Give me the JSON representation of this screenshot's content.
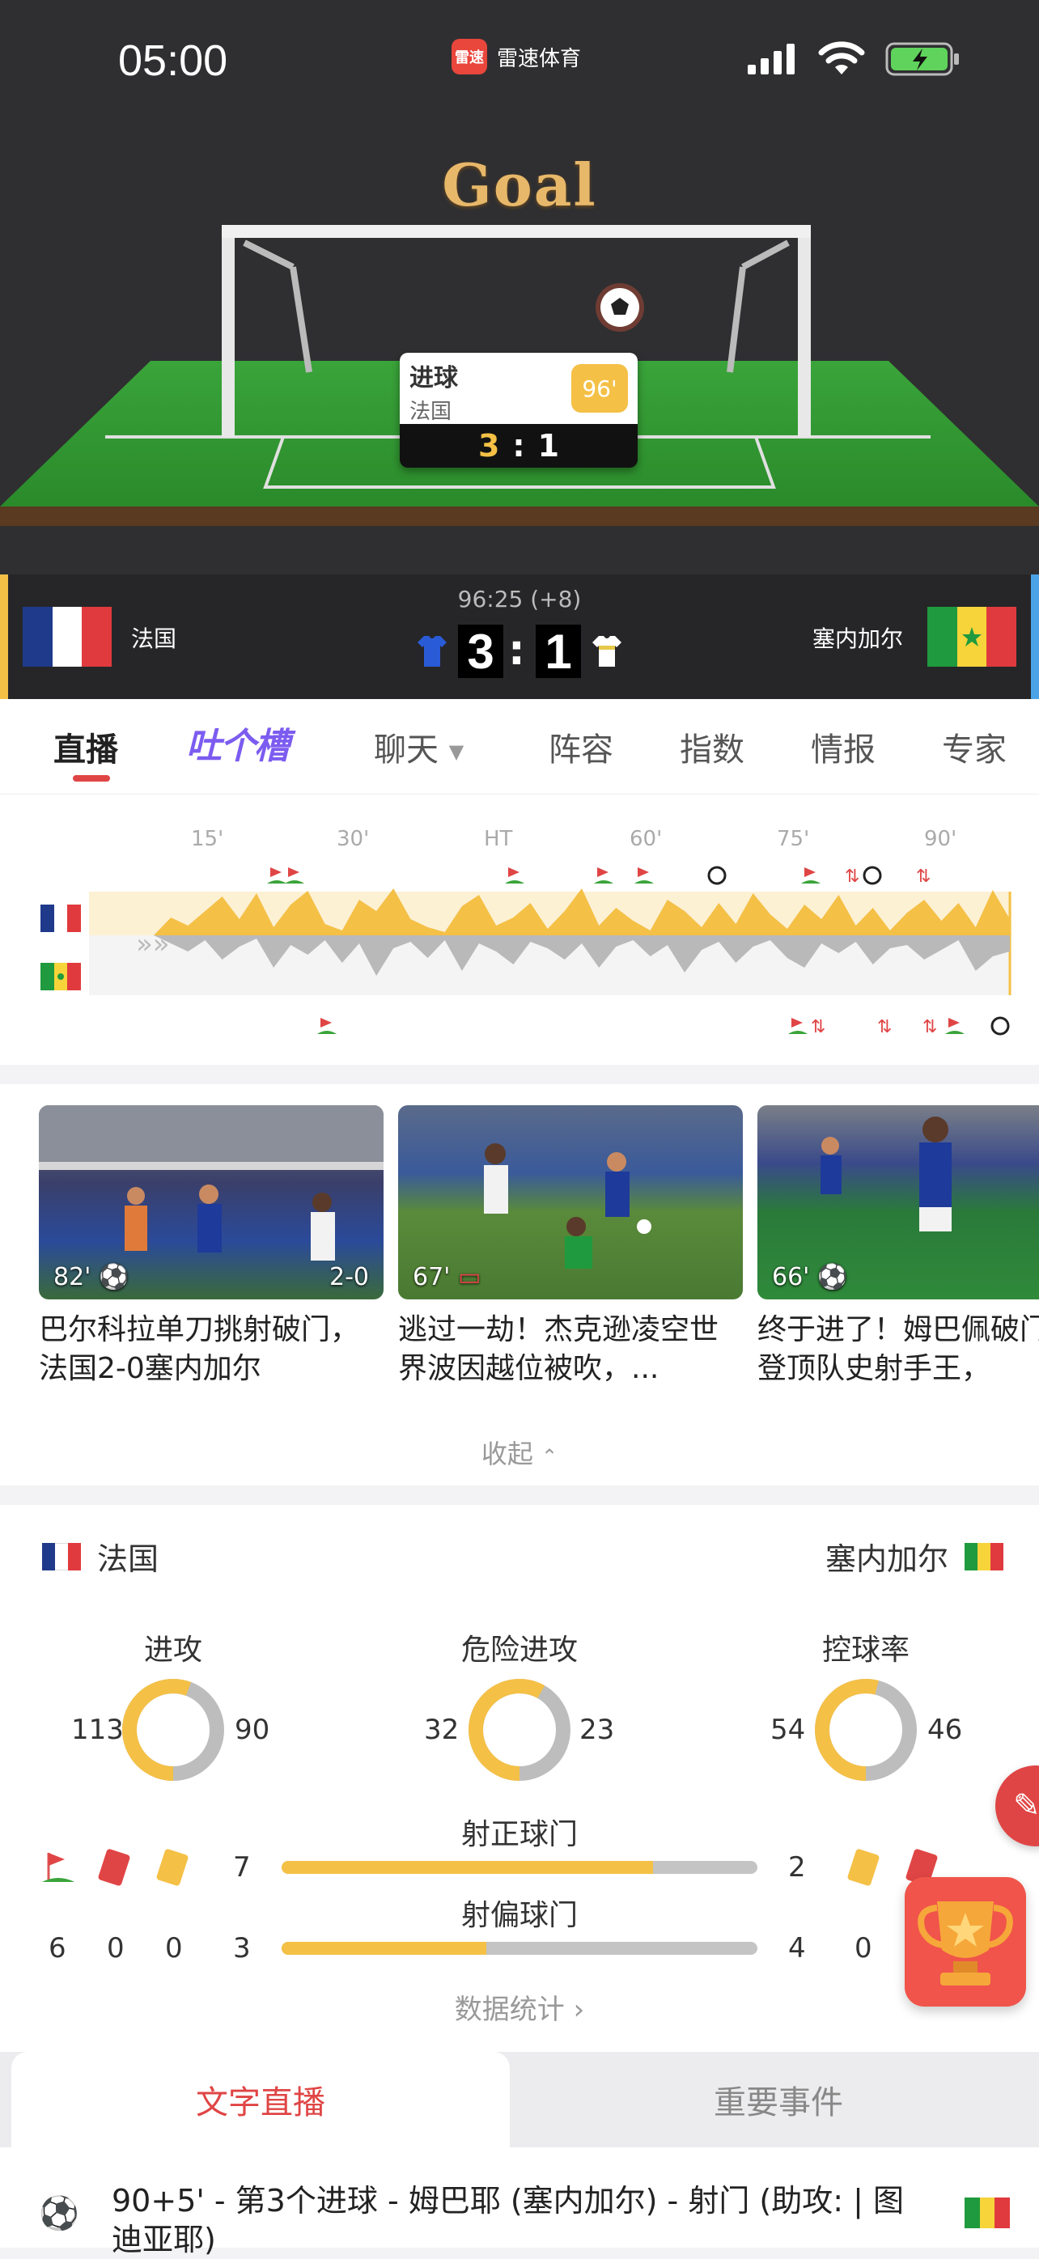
{
  "status": {
    "time": "05:00",
    "app_name": "雷速体育",
    "app_logo_text": "雷速"
  },
  "goal_banner": {
    "title": "Goal",
    "event_label": "进球",
    "event_team": "法国",
    "event_minute": "96'",
    "score_home": "3",
    "score_away": "1"
  },
  "match": {
    "home": {
      "name": "法国"
    },
    "away": {
      "name": "塞内加尔"
    },
    "clock": "96:25 (+8)",
    "score_home": "3",
    "score_away": "1",
    "colors": {
      "home_stripe": "#f4c046",
      "away_stripe": "#4aa3e6"
    }
  },
  "tabs": [
    {
      "label": "直播",
      "active": true
    },
    {
      "label": "吐个槽"
    },
    {
      "label": "聊天"
    },
    {
      "label": "阵容"
    },
    {
      "label": "指数"
    },
    {
      "label": "情报"
    },
    {
      "label": "专家"
    }
  ],
  "timeline": {
    "labels": [
      "15'",
      "30'",
      "HT",
      "60'",
      "75'",
      "90'"
    ]
  },
  "videos": [
    {
      "minute": "82'",
      "score": "2-0",
      "title": "巴尔科拉单刀挑射破门，法国2-0塞内加尔",
      "icon": "ball-icon"
    },
    {
      "minute": "67'",
      "title": "逃过一劫！杰克逊凌空世界波因越位被吹，...",
      "icon": "var-icon"
    },
    {
      "minute": "66'",
      "title": "终于进了！姆巴佩破门并登顶队史射手王，",
      "icon": "ball-icon"
    }
  ],
  "collapse_label": "收起",
  "stats": {
    "home_team": "法国",
    "away_team": "塞内加尔",
    "rings": [
      {
        "label": "进攻",
        "home": "113",
        "away": "90",
        "home_value": 113,
        "away_value": 90
      },
      {
        "label": "危险进攻",
        "home": "32",
        "away": "23",
        "home_value": 32,
        "away_value": 23
      },
      {
        "label": "控球率",
        "home": "54",
        "away": "46",
        "home_value": 54,
        "away_value": 46
      }
    ],
    "shots_on": {
      "label": "射正球门",
      "home": "7",
      "away": "2",
      "fraction": 0.78
    },
    "shots_off": {
      "label": "射偏球门",
      "home": "3",
      "away": "4",
      "fraction": 0.43
    },
    "home_cards": {
      "corners": "6",
      "red": "0",
      "yellow": "0"
    },
    "away_cards": {
      "yellow": "0"
    },
    "more_label": "数据统计"
  },
  "bottom_tabs": [
    {
      "label": "文字直播",
      "active": true
    },
    {
      "label": "重要事件"
    }
  ],
  "live_text": "90+5' - 第3个进球 - 姆巴耶 (塞内加尔) - 射门 (助攻: | 图迪亚耶)"
}
